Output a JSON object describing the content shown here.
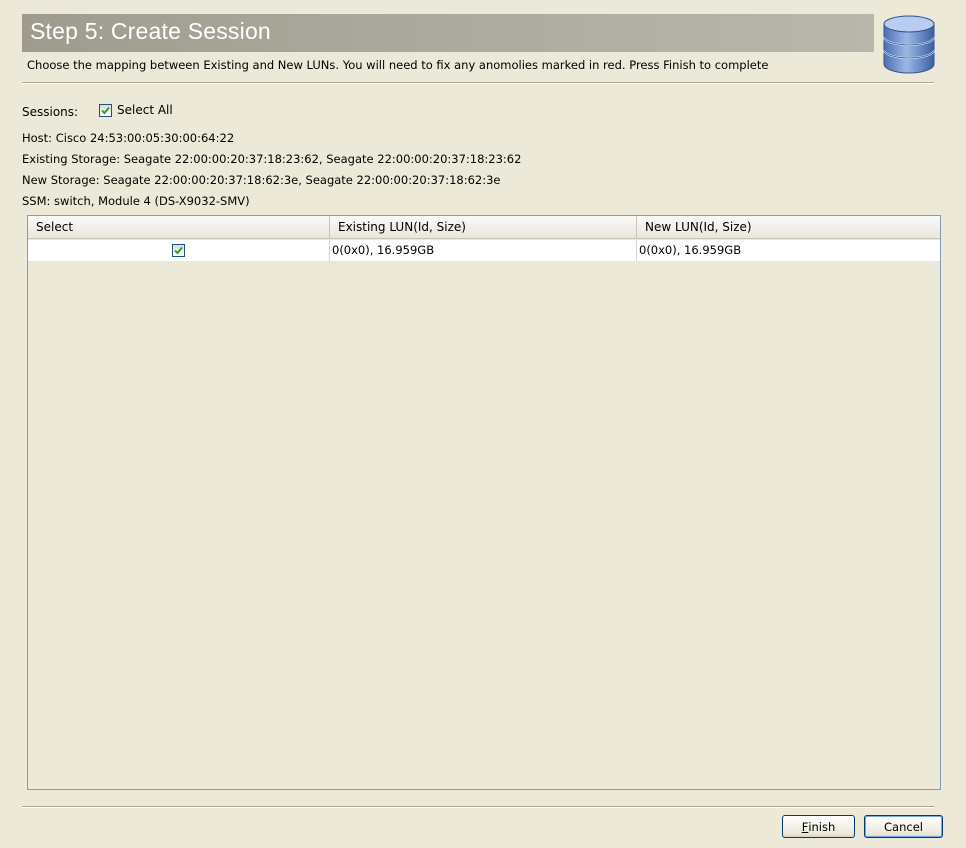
{
  "header": {
    "title": "Step 5: Create Session",
    "description": "Choose the mapping between Existing and New LUNs. You will need to fix any anomolies marked in red. Press Finish to complete",
    "icon": "database-icon"
  },
  "sessions": {
    "label": "Sessions:",
    "select_all_label": "Select All",
    "select_all_checked": true
  },
  "info": {
    "host": "Host: Cisco 24:53:00:05:30:00:64:22",
    "existing_storage": "Existing Storage: Seagate 22:00:00:20:37:18:23:62, Seagate 22:00:00:20:37:18:23:62",
    "new_storage": "New Storage: Seagate 22:00:00:20:37:18:62:3e, Seagate 22:00:00:20:37:18:62:3e",
    "ssm": "SSM: switch, Module 4 (DS-X9032-SMV)"
  },
  "table": {
    "columns": [
      "Select",
      "Existing LUN(Id, Size)",
      "New LUN(Id, Size)"
    ],
    "rows": [
      {
        "selected": true,
        "existing": "0(0x0), 16.959GB",
        "new": "0(0x0), 16.959GB"
      }
    ]
  },
  "buttons": {
    "finish_mnemonic": "F",
    "finish_rest": "inish",
    "cancel_label": "Cancel"
  },
  "colors": {
    "background": "#ece9d8",
    "title_band": "#aeaba0",
    "check": "#21a121",
    "table_border": "#7f9db9"
  }
}
